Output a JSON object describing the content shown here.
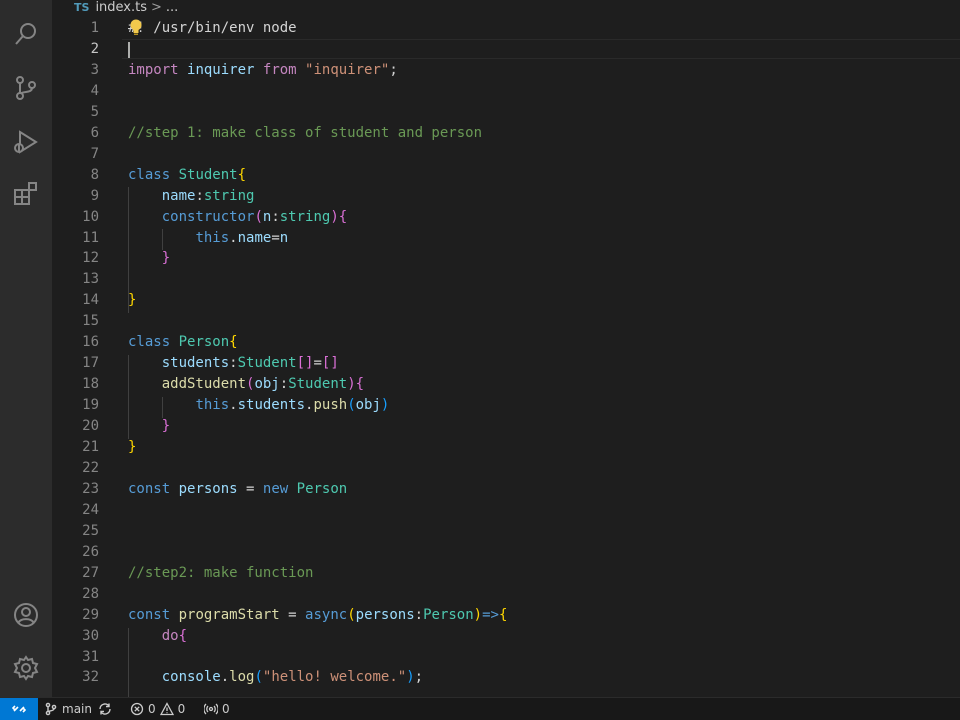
{
  "breadcrumb": {
    "file_badge": "TS",
    "file": "index.ts",
    "separator": ">",
    "more": "..."
  },
  "editor": {
    "line_numbers": [
      "1",
      "2",
      "3",
      "4",
      "5",
      "6",
      "7",
      "8",
      "9",
      "10",
      "11",
      "12",
      "13",
      "14",
      "15",
      "16",
      "17",
      "18",
      "19",
      "20",
      "21",
      "22",
      "23",
      "24",
      "25",
      "26",
      "27",
      "28",
      "29",
      "30",
      "31",
      "32"
    ],
    "code": [
      [
        {
          "t": "pl",
          "v": "#! /usr/bin/env node"
        }
      ],
      [],
      [
        {
          "t": "kw",
          "v": "import"
        },
        {
          "t": "pl",
          "v": " "
        },
        {
          "t": "var",
          "v": "inquirer"
        },
        {
          "t": "pl",
          "v": " "
        },
        {
          "t": "kw",
          "v": "from"
        },
        {
          "t": "pl",
          "v": " "
        },
        {
          "t": "str",
          "v": "\"inquirer\""
        },
        {
          "t": "pl",
          "v": ";"
        }
      ],
      [],
      [],
      [
        {
          "t": "cmt",
          "v": "//step 1: make class of student and person"
        }
      ],
      [],
      [
        {
          "t": "kb",
          "v": "class"
        },
        {
          "t": "pl",
          "v": " "
        },
        {
          "t": "cls",
          "v": "Student"
        },
        {
          "t": "b1",
          "v": "{"
        }
      ],
      [
        {
          "t": "pl",
          "v": "    "
        },
        {
          "t": "var",
          "v": "name"
        },
        {
          "t": "pl",
          "v": ":"
        },
        {
          "t": "cls",
          "v": "string"
        }
      ],
      [
        {
          "t": "pl",
          "v": "    "
        },
        {
          "t": "kb",
          "v": "constructor"
        },
        {
          "t": "b2",
          "v": "("
        },
        {
          "t": "var",
          "v": "n"
        },
        {
          "t": "pl",
          "v": ":"
        },
        {
          "t": "cls",
          "v": "string"
        },
        {
          "t": "b2",
          "v": ")"
        },
        {
          "t": "b2",
          "v": "{"
        }
      ],
      [
        {
          "t": "pl",
          "v": "        "
        },
        {
          "t": "kb",
          "v": "this"
        },
        {
          "t": "pl",
          "v": "."
        },
        {
          "t": "var",
          "v": "name"
        },
        {
          "t": "pl",
          "v": "="
        },
        {
          "t": "var",
          "v": "n"
        }
      ],
      [
        {
          "t": "pl",
          "v": "    "
        },
        {
          "t": "b2",
          "v": "}"
        }
      ],
      [],
      [
        {
          "t": "b1",
          "v": "}"
        }
      ],
      [],
      [
        {
          "t": "kb",
          "v": "class"
        },
        {
          "t": "pl",
          "v": " "
        },
        {
          "t": "cls",
          "v": "Person"
        },
        {
          "t": "b1",
          "v": "{"
        }
      ],
      [
        {
          "t": "pl",
          "v": "    "
        },
        {
          "t": "var",
          "v": "students"
        },
        {
          "t": "pl",
          "v": ":"
        },
        {
          "t": "cls",
          "v": "Student"
        },
        {
          "t": "b2",
          "v": "[]"
        },
        {
          "t": "pl",
          "v": "="
        },
        {
          "t": "b2",
          "v": "[]"
        }
      ],
      [
        {
          "t": "pl",
          "v": "    "
        },
        {
          "t": "fn",
          "v": "addStudent"
        },
        {
          "t": "b2",
          "v": "("
        },
        {
          "t": "var",
          "v": "obj"
        },
        {
          "t": "pl",
          "v": ":"
        },
        {
          "t": "cls",
          "v": "Student"
        },
        {
          "t": "b2",
          "v": ")"
        },
        {
          "t": "b2",
          "v": "{"
        }
      ],
      [
        {
          "t": "pl",
          "v": "        "
        },
        {
          "t": "kb",
          "v": "this"
        },
        {
          "t": "pl",
          "v": "."
        },
        {
          "t": "var",
          "v": "students"
        },
        {
          "t": "pl",
          "v": "."
        },
        {
          "t": "fn",
          "v": "push"
        },
        {
          "t": "b3",
          "v": "("
        },
        {
          "t": "var",
          "v": "obj"
        },
        {
          "t": "b3",
          "v": ")"
        }
      ],
      [
        {
          "t": "pl",
          "v": "    "
        },
        {
          "t": "b2",
          "v": "}"
        }
      ],
      [
        {
          "t": "b1",
          "v": "}"
        }
      ],
      [],
      [
        {
          "t": "kb",
          "v": "const"
        },
        {
          "t": "pl",
          "v": " "
        },
        {
          "t": "var",
          "v": "persons"
        },
        {
          "t": "pl",
          "v": " = "
        },
        {
          "t": "kb",
          "v": "new"
        },
        {
          "t": "pl",
          "v": " "
        },
        {
          "t": "cls",
          "v": "Person"
        }
      ],
      [],
      [],
      [],
      [
        {
          "t": "cmt",
          "v": "//step2: make function"
        }
      ],
      [],
      [
        {
          "t": "kb",
          "v": "const"
        },
        {
          "t": "pl",
          "v": " "
        },
        {
          "t": "fn",
          "v": "programStart"
        },
        {
          "t": "pl",
          "v": " = "
        },
        {
          "t": "kb",
          "v": "async"
        },
        {
          "t": "b1",
          "v": "("
        },
        {
          "t": "var",
          "v": "persons"
        },
        {
          "t": "pl",
          "v": ":"
        },
        {
          "t": "cls",
          "v": "Person"
        },
        {
          "t": "b1",
          "v": ")"
        },
        {
          "t": "kb",
          "v": "=>"
        },
        {
          "t": "b1",
          "v": "{"
        }
      ],
      [
        {
          "t": "pl",
          "v": "    "
        },
        {
          "t": "kw",
          "v": "do"
        },
        {
          "t": "b2",
          "v": "{"
        }
      ],
      [],
      [
        {
          "t": "pl",
          "v": "    "
        },
        {
          "t": "var",
          "v": "console"
        },
        {
          "t": "pl",
          "v": "."
        },
        {
          "t": "fn",
          "v": "log"
        },
        {
          "t": "b3",
          "v": "("
        },
        {
          "t": "str",
          "v": "\"hello! welcome.\""
        },
        {
          "t": "b3",
          "v": ")"
        },
        {
          "t": "pl",
          "v": ";"
        }
      ]
    ]
  },
  "status_bar": {
    "branch": "main",
    "errors": "0",
    "warnings": "0",
    "ports": "0"
  },
  "colors": {
    "accent": "#0078d4",
    "keyword": "#c586c0",
    "storage": "#569cd6",
    "type": "#4ec9b0",
    "variable": "#9cdcfe",
    "function": "#dcdcaa",
    "string": "#ce9178",
    "comment": "#6a9955"
  },
  "icons": {
    "activity": [
      "search-icon",
      "source-control-icon",
      "run-debug-icon",
      "extensions-icon",
      "account-icon",
      "settings-gear-icon"
    ],
    "status": [
      "remote-icon",
      "git-branch-icon",
      "sync-icon",
      "error-icon",
      "warning-icon",
      "ports-icon"
    ],
    "editor": [
      "lightbulb-icon"
    ]
  }
}
